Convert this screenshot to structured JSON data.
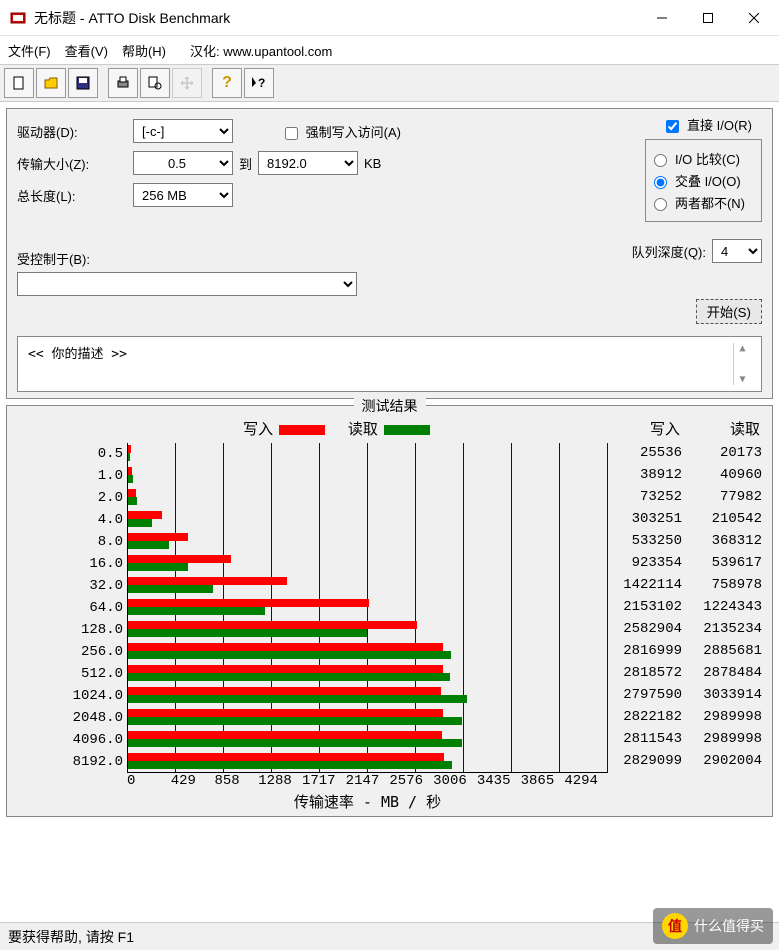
{
  "window": {
    "title": "无标题 - ATTO Disk Benchmark"
  },
  "menu": {
    "file": "文件(F)",
    "view": "查看(V)",
    "help": "帮助(H)",
    "credits": "汉化: www.upantool.com"
  },
  "toolbar_icons": [
    "new",
    "open",
    "save",
    "print",
    "preview",
    "move",
    "help",
    "whatsthis"
  ],
  "form": {
    "drive_label": "驱动器(D):",
    "drive_value": "[-c-]",
    "transfer_label": "传输大小(Z):",
    "transfer_from": "0.5",
    "to_label": "到",
    "transfer_to": "8192.0",
    "unit": "KB",
    "length_label": "总长度(L):",
    "length_value": "256 MB",
    "force_write": "强制写入访问(A)",
    "direct_io": "直接 I/O(R)",
    "radio1": "I/O 比较(C)",
    "radio2": "交叠 I/O(O)",
    "radio3": "两者都不(N)",
    "qdepth_label": "队列深度(Q):",
    "qdepth_value": "4",
    "controlled_label": "受控制于(B):",
    "start_btn": "开始(S)",
    "desc": "<<  你的描述   >>"
  },
  "results": {
    "title": "测试结果",
    "write_label": "写入",
    "read_label": "读取",
    "xaxis_label": "传输速率 - MB / 秒",
    "x_ticks": [
      "0",
      "429",
      "858",
      "1288",
      "1717",
      "2147",
      "2576",
      "3006",
      "3435",
      "3865",
      "4294"
    ],
    "max_x": 4294
  },
  "chart_data": {
    "type": "bar",
    "categories": [
      "0.5",
      "1.0",
      "2.0",
      "4.0",
      "8.0",
      "16.0",
      "32.0",
      "64.0",
      "128.0",
      "256.0",
      "512.0",
      "1024.0",
      "2048.0",
      "4096.0",
      "8192.0"
    ],
    "series": [
      {
        "name": "写入",
        "color": "#ff0000",
        "values": [
          25536,
          38912,
          73252,
          303251,
          533250,
          923354,
          1422114,
          2153102,
          2582904,
          2816999,
          2818572,
          2797590,
          2822182,
          2811543,
          2829099
        ]
      },
      {
        "name": "读取",
        "color": "#008000",
        "values": [
          20173,
          40960,
          77982,
          210542,
          368312,
          539617,
          758978,
          1224343,
          2135234,
          2885681,
          2878484,
          3033914,
          2989998,
          2989998,
          2902004
        ]
      }
    ],
    "xlabel": "传输速率 - MB / 秒",
    "ylabel": "",
    "xlim": [
      0,
      4294000
    ]
  },
  "status": "要获得帮助, 请按 F1",
  "watermark": "什么值得买"
}
